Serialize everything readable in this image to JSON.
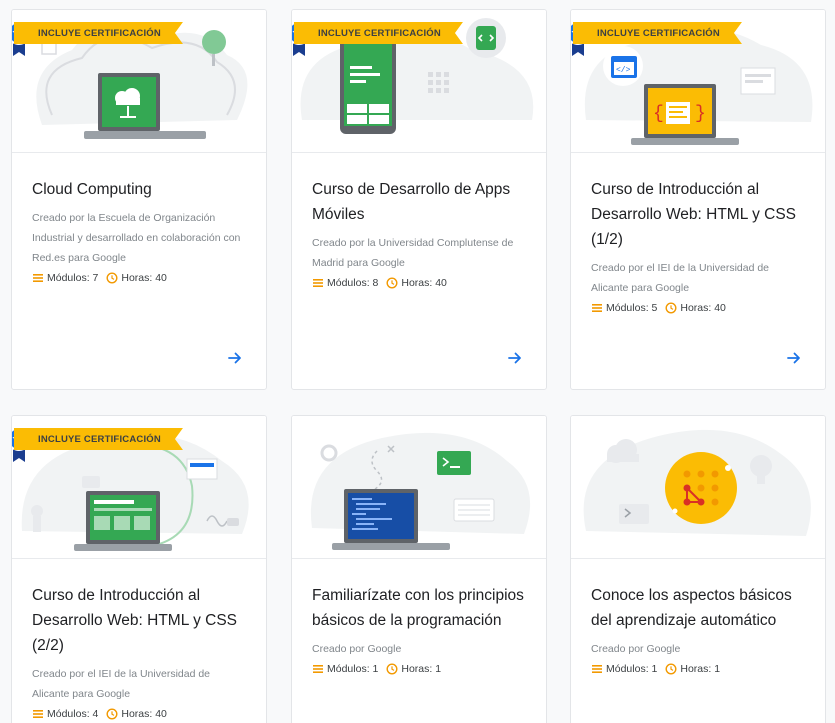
{
  "colors": {
    "accent": "#1a73e8",
    "badge": "#fbbc04",
    "meta_icon": "#f29900"
  },
  "courses": [
    {
      "badge": "INCLUYE CERTIFICACIÓN",
      "title": "Cloud Computing",
      "creator": "Creado por la Escuela de Organización Industrial y desarrollado en colaboración con Red.es para Google",
      "modules": "Módulos: 7",
      "hours": "Horas: 40",
      "illustration": "laptop-cloud-icon"
    },
    {
      "badge": "INCLUYE CERTIFICACIÓN",
      "title": "Curso de Desarrollo de Apps Móviles",
      "creator": "Creado por la Universidad Complutense de Madrid para Google",
      "modules": "Módulos: 8",
      "hours": "Horas: 40",
      "illustration": "smartphone-app-icon"
    },
    {
      "badge": "INCLUYE CERTIFICACIÓN",
      "title": "Curso de Introducción al Desarrollo Web: HTML y CSS (1/2)",
      "creator": "Creado por el IEI de la Universidad de Alicante para Google",
      "modules": "Módulos: 5",
      "hours": "Horas: 40",
      "illustration": "laptop-code-icon"
    },
    {
      "badge": "INCLUYE CERTIFICACIÓN",
      "title": "Curso de Introducción al Desarrollo Web: HTML y CSS (2/2)",
      "creator": "Creado por el IEI de la Universidad de Alicante para Google",
      "modules": "Módulos: 4",
      "hours": "Horas: 40",
      "illustration": "laptop-web-layout-icon"
    },
    {
      "title": "Familiarízate con los principios básicos de la programación",
      "creator": "Creado por Google",
      "modules": "Módulos: 1",
      "hours": "Horas: 1",
      "illustration": "laptop-terminal-icon"
    },
    {
      "title": "Conoce los aspectos básicos del aprendizaje automático",
      "creator": "Creado por Google",
      "modules": "Módulos: 1",
      "hours": "Horas: 1",
      "illustration": "machine-learning-icon"
    }
  ]
}
